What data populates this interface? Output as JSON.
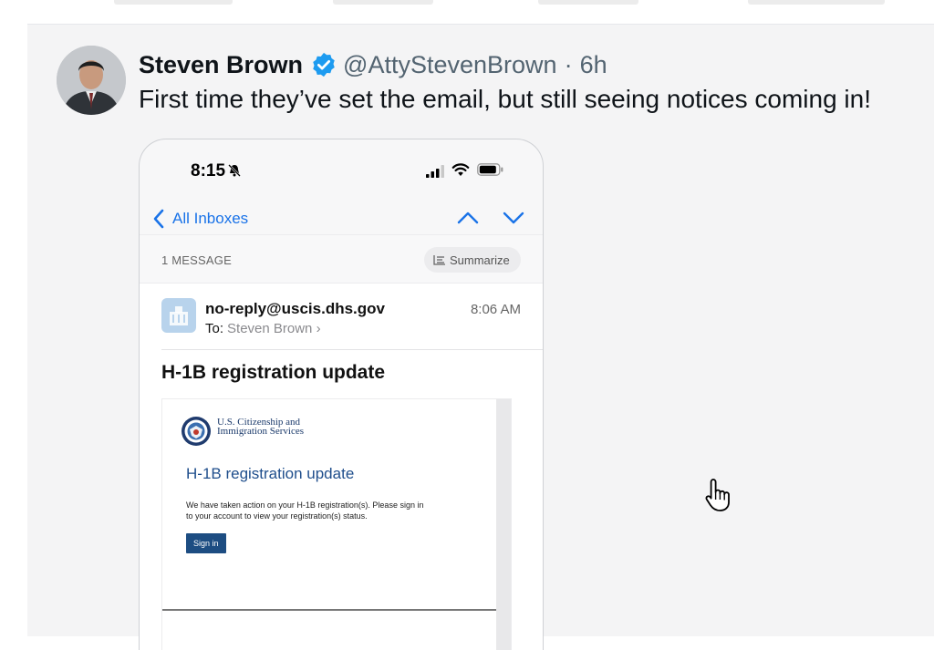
{
  "tweet": {
    "author_name": "Steven Brown",
    "handle": "@AttyStevenBrown",
    "separator": "·",
    "time_ago": "6h",
    "text": "First time they’ve set the email, but still seeing notices coming in!",
    "verified_color": "#1d9bf0"
  },
  "phone": {
    "status_time": "8:15",
    "back_label": "All Inboxes",
    "thread": {
      "message_count": "1 MESSAGE",
      "summarize_label": "Summarize"
    },
    "email": {
      "sender": "no-reply@uscis.dhs.gov",
      "to_label": "To:",
      "recipient": "Steven Brown ›",
      "time": "8:06 AM",
      "subject": "H-1B registration update",
      "body": {
        "logo_text": "U.S. Citizenship and Immigration Services",
        "heading": "H-1B registration update",
        "text": "We have taken action on your H-1B registration(s). Please sign in to your account to view your registration(s) status.",
        "signin_label": "Sign in"
      }
    }
  },
  "colors": {
    "link_blue": "#1a73e8",
    "uscis_navy": "#1d4d82",
    "tweet_bg": "#f4f4f5"
  }
}
